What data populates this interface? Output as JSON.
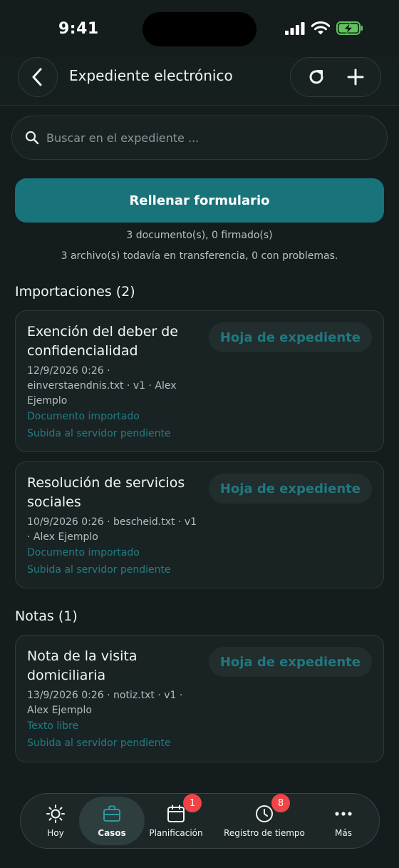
{
  "status_bar": {
    "time": "9:41"
  },
  "header": {
    "title": "Expediente electrónico"
  },
  "search": {
    "placeholder": "Buscar en el expediente ..."
  },
  "primary_button": {
    "label": "Rellenar formulario"
  },
  "summary": {
    "documents": "3 documento(s), 0 firmado(s)",
    "transfers": "3 archivo(s) todavía en transferencia, 0 con problemas."
  },
  "sections": [
    {
      "title": "Importaciones (2)",
      "cards": [
        {
          "title": "Exención del deber de confidencialidad",
          "meta": "12/9/2026 0:26 · einverstaendnis.txt · v1 · Alex Ejemplo",
          "status": "Documento importado",
          "upload": "Subida al servidor pendiente",
          "chip": "Hoja de expediente"
        },
        {
          "title": "Resolución de servicios sociales",
          "meta": "10/9/2026 0:26 · bescheid.txt · v1 · Alex Ejemplo",
          "status": "Documento importado",
          "upload": "Subida al servidor pendiente",
          "chip": "Hoja de expediente"
        }
      ]
    },
    {
      "title": "Notas (1)",
      "cards": [
        {
          "title": "Nota de la visita domiciliaria",
          "meta": "13/9/2026 0:26 · notiz.txt · v1 · Alex Ejemplo",
          "status": "Texto libre",
          "upload": "Subida al servidor pendiente",
          "chip": "Hoja de expediente"
        }
      ]
    }
  ],
  "tabbar": {
    "items": [
      {
        "label": "Hoy",
        "icon": "sun-icon",
        "active": false
      },
      {
        "label": "Casos",
        "icon": "briefcase-icon",
        "active": true
      },
      {
        "label": "Planificación",
        "icon": "calendar-icon",
        "badge": "1"
      },
      {
        "label": "Registro de tiempo",
        "icon": "clock-icon",
        "badge": "8"
      },
      {
        "label": "Más",
        "icon": "more-icon"
      }
    ]
  },
  "colors": {
    "background": "#141c1d",
    "accent": "#19737a",
    "accent_text": "#1f7e85",
    "badge": "#f04447"
  }
}
